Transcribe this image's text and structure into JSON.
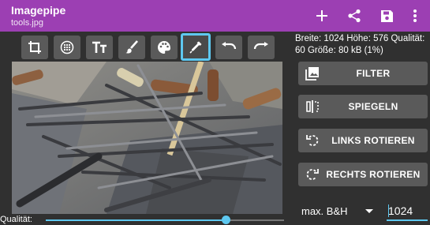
{
  "app": {
    "title": "Imagepipe",
    "subtitle": "tools.jpg",
    "bar_color": "#9C3FB3"
  },
  "appbar_actions": [
    {
      "icon": "plus-icon"
    },
    {
      "icon": "share-icon"
    },
    {
      "icon": "save-icon"
    },
    {
      "icon": "more-vert-icon"
    }
  ],
  "toolbar": [
    {
      "icon": "crop-icon"
    },
    {
      "icon": "blur-icon"
    },
    {
      "icon": "text-icon"
    },
    {
      "icon": "brush-icon"
    },
    {
      "icon": "palette-icon"
    },
    {
      "icon": "color-picker-icon",
      "selected": true
    },
    {
      "icon": "undo-icon"
    },
    {
      "icon": "redo-icon"
    }
  ],
  "info": {
    "text": "Breite: 1024 Höhe: 576 Qualität: 60 Größe: 80 kB (1%)"
  },
  "side_buttons": {
    "filter": "FILTER",
    "mirror": "SPIEGELN",
    "rotate_left": "LINKS ROTIEREN",
    "rotate_right": "RECHTS ROTIEREN"
  },
  "quality": {
    "label": "Qualität:",
    "value_fraction": 0.76
  },
  "size_select": {
    "value": "max. B&H"
  },
  "size_input": {
    "value": "1024"
  },
  "colors": {
    "accent": "#5ec8f0",
    "button_bg": "#5a5a5a",
    "background": "#303030"
  }
}
